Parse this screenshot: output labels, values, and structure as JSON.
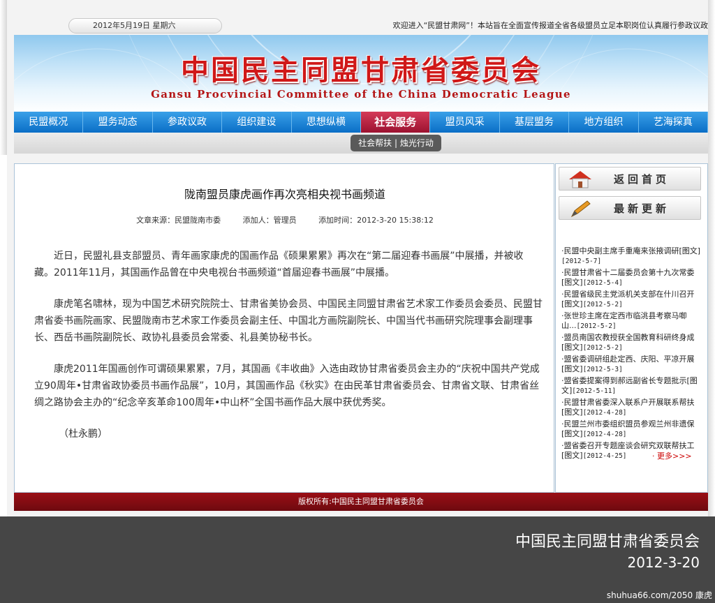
{
  "topbar": {
    "date": "2012年5月19日 星期六",
    "marquee": "欢迎进入“民盟甘肃网”！本站旨在全面宣传报道全省各级盟员立足本职岗位认真履行参政议政"
  },
  "header": {
    "title": "中国民主同盟甘肃省委员会",
    "subtitle": "Gansu Procvincial Committee of the China Democratic League"
  },
  "nav": {
    "items": [
      "民盟概况",
      "盟务动态",
      "参政议政",
      "组织建设",
      "思想纵横",
      "社会服务",
      "盟员风采",
      "基层盟务",
      "地方组织",
      "艺海探真"
    ],
    "active": "社会服务"
  },
  "subnav": {
    "label": "社会帮扶 | 烛光行动"
  },
  "article": {
    "title": "陇南盟员康虎画作再次亮相央视书画频道",
    "source": "文章来源：民盟陇南市委",
    "author": "添加人：管理员",
    "time": "添加时间：2012-3-20 15:38:12",
    "paragraphs": [
      "近日，民盟礼县支部盟员、青年画家康虎的国画作品《硕果累累》再次在“第二届迎春书画展”中展播，并被收藏。2011年11月，其国画作品曾在中央电视台书画频道“首届迎春书画展”中展播。",
      "康虎笔名啸林，现为中国艺术研究院院士、甘肃省美协会员、中国民主同盟甘肃省艺术家工作委员会委员、民盟甘肃省委书画院画家、民盟陇南市艺术家工作委员会副主任、中国北方画院副院长、中国当代书画研究院理事会副理事长、西岳书画院副院长、政协礼县委员会常委、礼县美协秘书长。",
      "康虎2011年国画创作可谓硕果累累，7月，其国画《丰收曲》入选由政协甘肃省委员会主办的“庆祝中国共产党成立90周年•甘肃省政协委员书画作品展”，10月，其国画作品《秋实》在由民革甘肃省委员会、甘肃省文联、甘肃省丝绸之路协会主办的“纪念辛亥革命100周年•中山杯”全国书画作品大展中获优秀奖。"
    ],
    "signature": "（杜永鹏）"
  },
  "sidebar": {
    "home_label": "返回首页",
    "latest_label": "最新更新",
    "news": [
      {
        "text": "民盟中央副主席手重庵来张掖调研[图文]",
        "date": "[2012-5-7]"
      },
      {
        "text": "民盟甘肃省十二届委员会第十九次常委[图文]",
        "date": "[2012-5-4]"
      },
      {
        "text": "民盟省级民主党派机关支部在什川召开[图文]",
        "date": "[2012-5-2]"
      },
      {
        "text": "张世珍主席在定西市临洮县考察马啣山...",
        "date": "[2012-5-2]"
      },
      {
        "text": "盟员南国农教授获全国教育科研终身成[图文]",
        "date": "[2012-5-2]"
      },
      {
        "text": "盟省委调研组赴定西、庆阳、平凉开展[图文]",
        "date": "[2012-5-3]"
      },
      {
        "text": "盟省委提案得到郝远副省长专题批示[图文]",
        "date": "[2012-5-11]"
      },
      {
        "text": "民盟甘肃省委深入联系户开展联系帮扶[图文]",
        "date": "[2012-4-28]"
      },
      {
        "text": "民盟兰州市委组织盟员参观兰州非遗保[图文]",
        "date": "[2012-4-28]"
      },
      {
        "text": "盟省委召开专题座谈会研究双联帮扶工[图文]",
        "date": "[2012-4-25]"
      }
    ],
    "more": "· 更多>>>"
  },
  "footer": {
    "copyright": "版权所有:中国民主同盟甘肃省委员会"
  },
  "caption": {
    "title": "中国民主同盟甘肃省委员会",
    "date": "2012-3-20",
    "credit": "shuhua66.com/2050 康虎"
  },
  "colors": {
    "nav_blue": "#1a7fd4",
    "nav_active": "#b8203f",
    "title_red": "#d01818",
    "footer_red": "#8a0d14",
    "caption_gray": "#464646"
  }
}
